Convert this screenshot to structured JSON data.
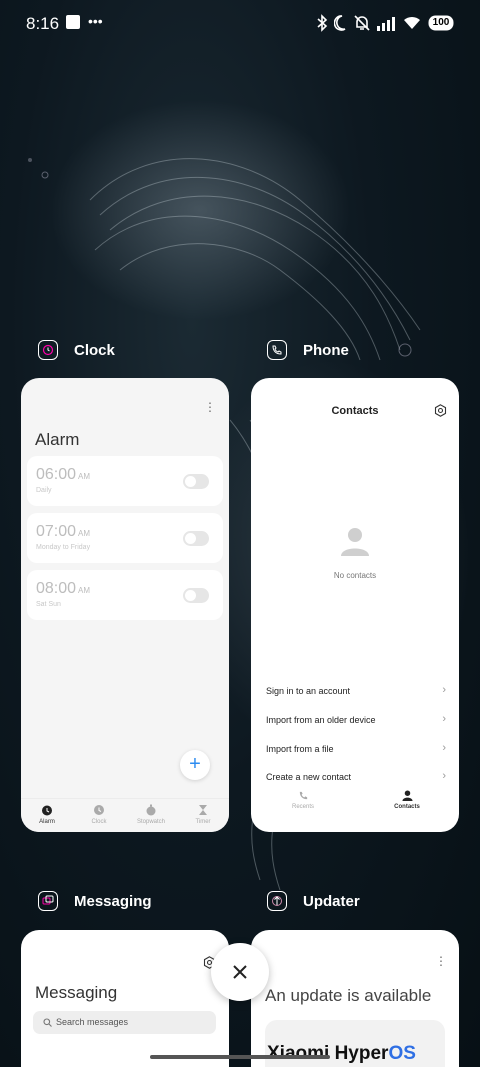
{
  "status_bar": {
    "time": "8:16",
    "battery": "100",
    "icons": [
      "notification-square-icon",
      "more-dots-icon",
      "bluetooth-icon",
      "moon-icon",
      "bell-off-icon",
      "signal-icon",
      "wifi-icon",
      "battery-icon"
    ]
  },
  "apps": {
    "clock": {
      "name": "Clock",
      "screen_title": "Alarm",
      "alarms": [
        {
          "time": "06:00",
          "ampm": "AM",
          "repeat": "Daily"
        },
        {
          "time": "07:00",
          "ampm": "AM",
          "repeat": "Monday to Friday"
        },
        {
          "time": "08:00",
          "ampm": "AM",
          "repeat": "Sat Sun"
        }
      ],
      "nav": [
        "Alarm",
        "Clock",
        "Stopwatch",
        "Timer"
      ],
      "add_label": "+"
    },
    "phone": {
      "name": "Phone",
      "screen_title": "Contacts",
      "empty_text": "No contacts",
      "actions": [
        "Sign in to an account",
        "Import from an older device",
        "Import from a file",
        "Create a new contact"
      ],
      "nav": [
        "Recents",
        "Contacts"
      ]
    },
    "messaging": {
      "name": "Messaging",
      "screen_title": "Messaging",
      "search_placeholder": "Search messages"
    },
    "updater": {
      "name": "Updater",
      "screen_title": "An update is available",
      "brand_prefix": "Xiaomi Hyper",
      "brand_suffix": "OS"
    }
  },
  "colors": {
    "accent": "#2d8cf0",
    "updater_brand": "#2f6fe4"
  }
}
